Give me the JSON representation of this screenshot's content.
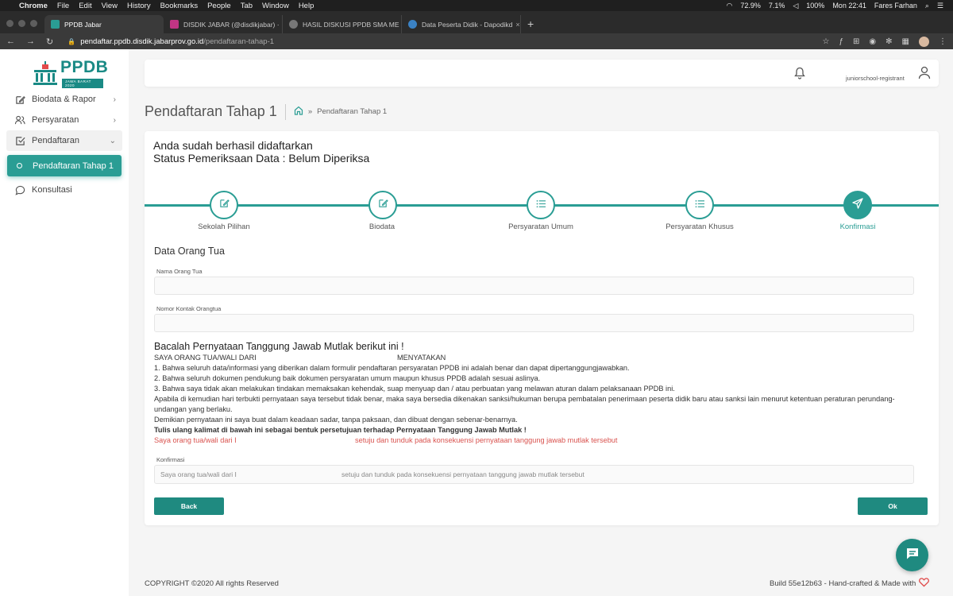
{
  "menubar": {
    "app": "Chrome",
    "items": [
      "File",
      "Edit",
      "View",
      "History",
      "Bookmarks",
      "People",
      "Tab",
      "Window",
      "Help"
    ],
    "battery_cpu": "72.9%",
    "cpu2": "7.1%",
    "battery": "100%",
    "clock": "Mon 22:41",
    "user": "Fares Farhan"
  },
  "tabs": [
    {
      "title": "PPDB Jabar",
      "color": "#2a9d94",
      "close": ""
    },
    {
      "title": "DISDIK JABAR (@disdikjabar) ·",
      "color": "#c13584",
      "close": "×"
    },
    {
      "title": "HASIL DISKUSI PPDB SMA ME",
      "color": "#777777",
      "close": "×"
    },
    {
      "title": "Data Peserta Didik - Dapodikd",
      "color": "#3b82c4",
      "close": "×"
    }
  ],
  "address": {
    "domain": "pendaftar.ppdb.disdik.jabarprov.go.id",
    "path": "/pendaftaran-tahap-1"
  },
  "sidebar": {
    "logo_text": "PPDB",
    "logo_sub": "JAWA BARAT 2020",
    "items": [
      {
        "label": "Biodata & Rapor",
        "icon": "edit-icon"
      },
      {
        "label": "Persyaratan",
        "icon": "users-icon"
      },
      {
        "label": "Pendaftaran",
        "icon": "check-square-icon"
      },
      {
        "label": "Pendaftaran Tahap 1",
        "icon": "circle-icon"
      },
      {
        "label": "Konsultasi",
        "icon": "chat-icon"
      }
    ]
  },
  "header": {
    "username": "juniorschool-registrant"
  },
  "page": {
    "title": "Pendaftaran Tahap 1",
    "breadcrumb_sep": "»",
    "breadcrumb": "Pendaftaran Tahap 1"
  },
  "status": {
    "line1": "Anda sudah berhasil didaftarkan",
    "line2": "Status Pemeriksaan Data : Belum Diperiksa"
  },
  "steps": [
    {
      "label": "Sekolah Pilihan",
      "icon": "edit-icon",
      "active": false
    },
    {
      "label": "Biodata",
      "icon": "edit-icon",
      "active": false
    },
    {
      "label": "Persyaratan Umum",
      "icon": "list-icon",
      "active": false
    },
    {
      "label": "Persyaratan Khusus",
      "icon": "list-icon",
      "active": false
    },
    {
      "label": "Konfirmasi",
      "icon": "send-icon",
      "active": true
    }
  ],
  "form": {
    "section_title": "Data Orang Tua",
    "nama_label": "Nama Orang Tua",
    "nama_value": "",
    "kontak_label": "Nomor Kontak Orangtua",
    "kontak_value": ""
  },
  "statement": {
    "heading": "Bacalah Pernyataan Tanggung Jawab Mutlak berikut ini !",
    "saya": "SAYA ORANG TUA/WALI DARI",
    "menyatakan": "MENYATAKAN",
    "p1": "1. Bahwa seluruh data/informasi yang diberikan dalam formulir pendaftaran persyaratan PPDB ini adalah benar dan dapat dipertanggungjawabkan.",
    "p2": "2. Bahwa seluruh dokumen pendukung baik dokumen persyaratan umum maupun khusus PPDB adalah sesuai aslinya.",
    "p3": "3. Bahwa saya tidak akan melakukan tindakan memaksakan kehendak, suap menyuap dan / atau perbuatan yang melawan aturan dalam pelaksanaan PPDB ini.",
    "p4": "Apabila di kemudian hari terbukti pernyataan saya tersebut tidak benar, maka saya bersedia dikenakan sanksi/hukuman berupa pembatalan penerimaan peserta didik baru atau sanksi lain menurut ketentuan peraturan perundang-undangan yang berlaku.",
    "p5": "Demikian pernyataan ini saya buat dalam keadaan sadar, tanpa paksaan, dan dibuat dengan sebenar-benarnya.",
    "instruction": "Tulis ulang kalimat di bawah ini sebagai bentuk persetujuan terhadap Pernyataan Tanggung Jawab Mutlak !",
    "red_a": "Saya orang tua/wali dari I",
    "red_b": "setuju dan tunduk pada konsekuensi pernyataan tanggung jawab mutlak tersebut"
  },
  "konfirmasi": {
    "label": "Konfirmasi",
    "value_a": "Saya orang tua/wali dari I",
    "value_b": "setuju dan tunduk pada konsekuensi pernyataan tanggung jawab mutlak tersebut"
  },
  "buttons": {
    "back": "Back",
    "ok": "Ok"
  },
  "footer": {
    "copyright": "COPYRIGHT ©2020 All rights Reserved",
    "build": "Build 55e12b63 -  Hand-crafted & Made with"
  },
  "colors": {
    "accent": "#2a9d94",
    "button": "#1f8a80",
    "danger": "#d9534f"
  }
}
